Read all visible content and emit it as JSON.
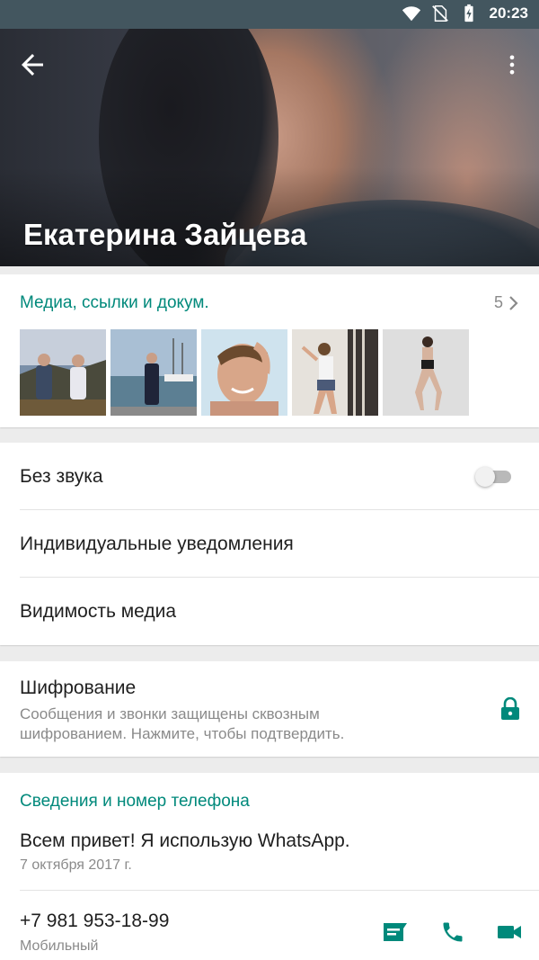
{
  "status_bar": {
    "time": "20:23",
    "icons": [
      "wifi-icon",
      "no-sim-icon",
      "battery-charging-icon"
    ]
  },
  "header": {
    "contact_name": "Екатерина Зайцева",
    "icons": {
      "back": "arrow-left-icon",
      "menu": "more-vertical-icon"
    }
  },
  "media": {
    "title": "Медиа, ссылки и докум.",
    "count": "5",
    "icon": "chevron-right-icon",
    "thumbnails": [
      {
        "name": "media-thumbnail-1"
      },
      {
        "name": "media-thumbnail-2"
      },
      {
        "name": "media-thumbnail-3"
      },
      {
        "name": "media-thumbnail-4"
      },
      {
        "name": "media-thumbnail-5"
      }
    ]
  },
  "settings": {
    "mute_label": "Без звука",
    "mute_enabled": false,
    "custom_notifications_label": "Индивидуальные уведомления",
    "media_visibility_label": "Видимость медиа"
  },
  "encryption": {
    "title": "Шифрование",
    "description": "Сообщения и звонки защищены сквозным шифрованием. Нажмите, чтобы подтвердить.",
    "icon": "lock-icon"
  },
  "info": {
    "title": "Сведения и номер телефона",
    "about": "Всем привет! Я использую WhatsApp.",
    "about_date": "7 октября 2017 г.",
    "phone": "+7 981 953-18-99",
    "phone_type": "Мобильный",
    "actions": [
      "message-icon",
      "phone-icon",
      "video-call-icon"
    ]
  },
  "colors": {
    "accent": "#00897b",
    "status_bar": "#43565f",
    "background": "#ececec"
  }
}
